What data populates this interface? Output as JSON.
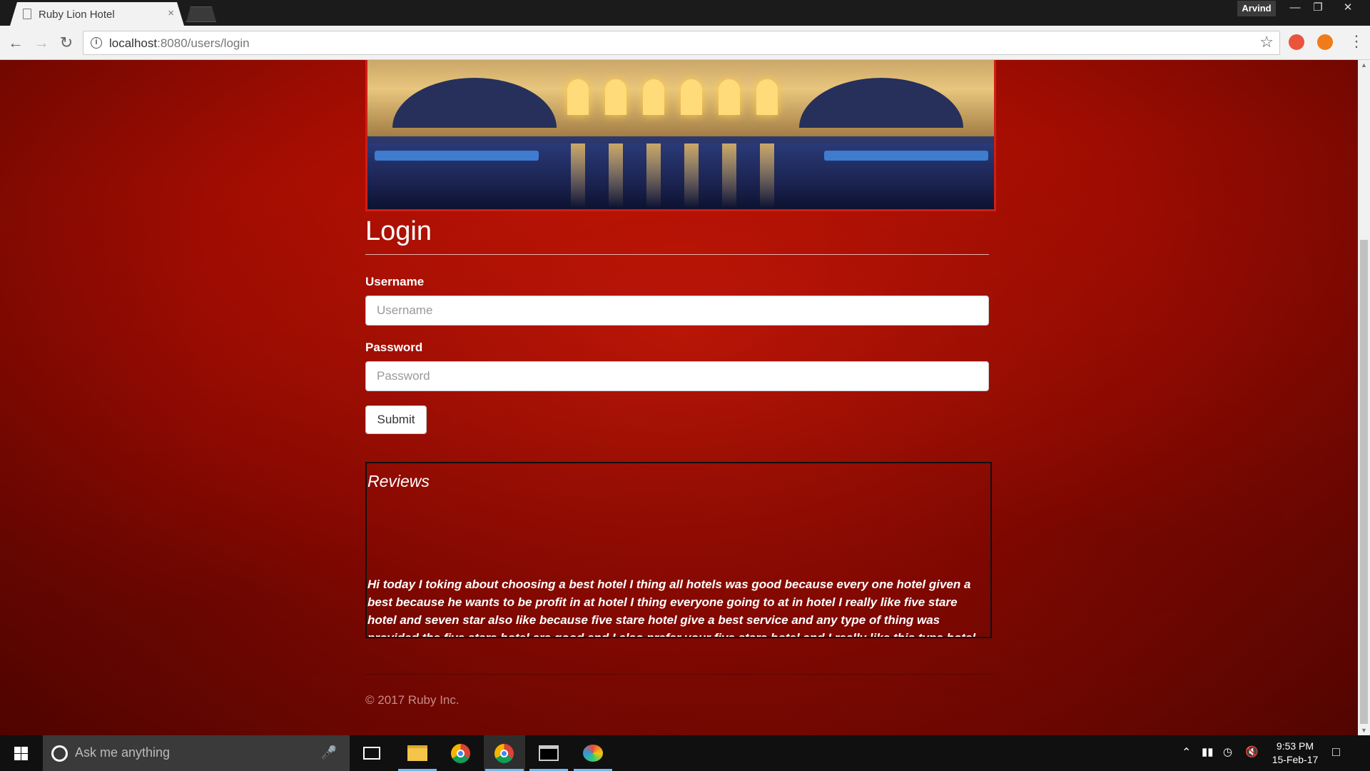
{
  "browser": {
    "tab_title": "Ruby Lion Hotel",
    "tab_close": "×",
    "profile_name": "Arvind",
    "url_host": "localhost",
    "url_rest": ":8080/users/login"
  },
  "page": {
    "title": "Login",
    "username_label": "Username",
    "username_placeholder": "Username",
    "password_label": "Password",
    "password_placeholder": "Password",
    "submit_label": "Submit",
    "reviews_title": "Reviews",
    "review_text": "Hi today I toking about choosing a best hotel I thing all hotels was good because every one hotel given a best because he wants to be profit in at hotel I thing everyone going to at in hotel I really like five stare hotel and seven star also like because five stare hotel give a best service and any type of thing was provided the five stare hotel are good and I also prefer your five stare hotel and I really like this type hotel because I feel...",
    "footer": "© 2017 Ruby Inc.",
    "accent_color": "#a50e02"
  },
  "taskbar": {
    "search_placeholder": "Ask me anything",
    "time": "9:53 PM",
    "date": "15-Feb-17"
  },
  "icons": [
    "page-icon",
    "back-icon",
    "forward-icon",
    "reload-icon",
    "info-icon",
    "star-icon",
    "windows-start-icon",
    "cortana-icon",
    "mic-icon",
    "task-view-icon",
    "file-explorer-icon",
    "chrome-icon",
    "terminal-icon",
    "paint-icon",
    "network-icon",
    "volume-icon",
    "notification-icon"
  ]
}
